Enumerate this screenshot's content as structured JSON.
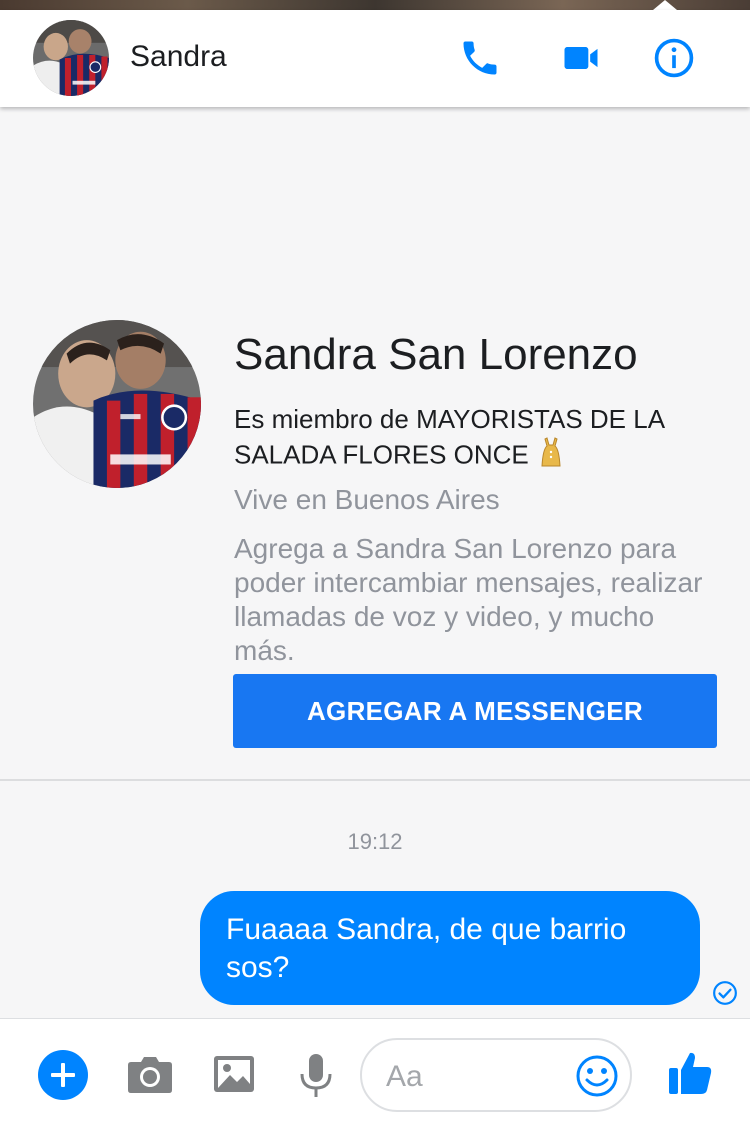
{
  "header": {
    "contact_name": "Sandra",
    "icons": [
      "phone-icon",
      "video-camera-icon",
      "info-icon"
    ]
  },
  "profile": {
    "full_name": "Sandra San Lorenzo",
    "group_text": "Es miembro de MAYORISTAS DE LA SALADA FLORES ONCE",
    "group_emoji": "dress-emoji",
    "location": "Vive en Buenos Aires",
    "description": "Agrega a Sandra San Lorenzo para poder intercambiar mensajes, realizar llamadas de voz y video, y mucho más.",
    "add_button_label": "AGREGAR A MESSENGER"
  },
  "conversation": {
    "timestamp": "19:12",
    "messages": [
      {
        "direction": "outgoing",
        "text": "Fuaaaa Sandra, de que barrio sos?",
        "status": "delivered"
      }
    ]
  },
  "composer": {
    "placeholder": "Aa",
    "icons": [
      "plus-icon",
      "camera-icon",
      "image-icon",
      "microphone-icon",
      "emoji-icon",
      "thumbs-up-icon"
    ]
  },
  "colors": {
    "accent": "#0084ff",
    "button_blue": "#1877f2",
    "muted_text": "#90949c",
    "background": "#f6f6f7"
  }
}
